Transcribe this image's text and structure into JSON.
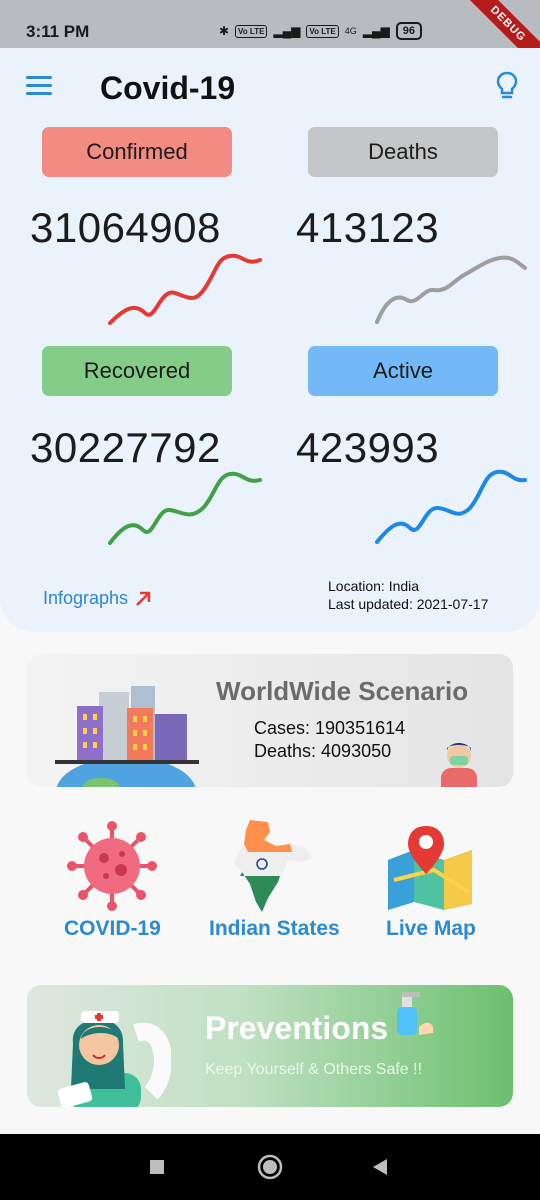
{
  "status_bar": {
    "time": "3:11 PM",
    "battery": "96",
    "lte1": "Vo LTE",
    "lte2": "Vo LTE",
    "net4g": "4G",
    "debug": "DEBUG"
  },
  "header": {
    "title": "Covid-19"
  },
  "stats": [
    {
      "label": "Confirmed",
      "value": "31064908",
      "chip_color": "#f28b82",
      "line_color": "#e53935"
    },
    {
      "label": "Deaths",
      "value": "413123",
      "chip_color": "#c4c6c8",
      "line_color": "#9e9e9e"
    },
    {
      "label": "Recovered",
      "value": "30227792",
      "chip_color": "#86cc89",
      "line_color": "#43a047"
    },
    {
      "label": "Active",
      "value": "423993",
      "chip_color": "#74b9f7",
      "line_color": "#1e88e5"
    }
  ],
  "footer": {
    "infographs": "Infographs",
    "location": "Location: India",
    "updated": "Last updated: 2021-07-17"
  },
  "worldwide": {
    "title": "WorldWide Scenario",
    "cases": "Cases: 190351614",
    "deaths": "Deaths: 4093050"
  },
  "shortcuts": [
    {
      "label": "COVID-19",
      "icon": "virus-icon"
    },
    {
      "label": "Indian States",
      "icon": "india-map-icon"
    },
    {
      "label": "Live Map",
      "icon": "map-pin-icon"
    }
  ],
  "preventions": {
    "title": "Preventions",
    "subtitle": "Keep Yourself & Others Safe !!"
  },
  "colors": {
    "accent": "#2a8ad6",
    "panel": "#eaf2fb"
  }
}
